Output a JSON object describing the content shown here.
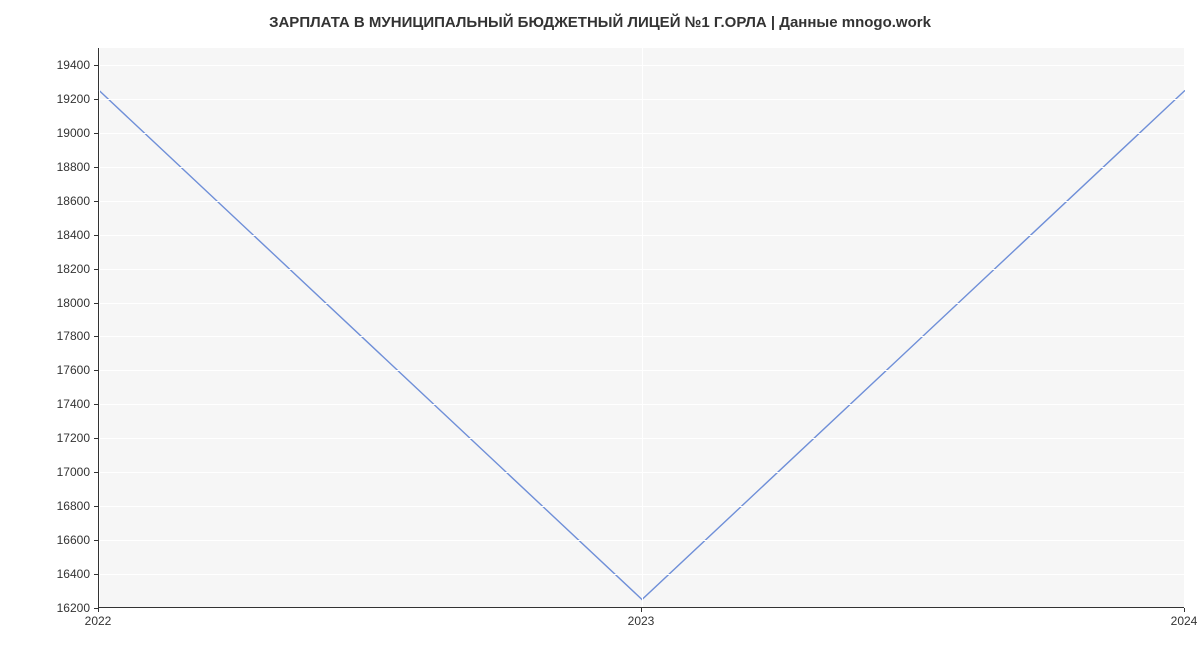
{
  "chart_data": {
    "type": "line",
    "title": "ЗАРПЛАТА В МУНИЦИПАЛЬНЫЙ БЮДЖЕТНЫЙ ЛИЦЕЙ №1 Г.ОРЛА | Данные mnogo.work",
    "xlabel": "",
    "ylabel": "",
    "x": [
      2022,
      2023,
      2024
    ],
    "series": [
      {
        "name": "Зарплата",
        "values": [
          19250,
          16250,
          19250
        ]
      }
    ],
    "y_ticks": [
      16200,
      16400,
      16600,
      16800,
      17000,
      17200,
      17400,
      17600,
      17800,
      18000,
      18200,
      18400,
      18600,
      18800,
      19000,
      19200,
      19400
    ],
    "x_ticks": [
      2022,
      2023,
      2024
    ],
    "ylim": [
      16200,
      19500
    ],
    "xlim": [
      2022,
      2024
    ],
    "colors": {
      "line": "#6f8fd8",
      "plot_bg": "#f6f6f6",
      "grid": "#ffffff",
      "axis": "#333333"
    }
  }
}
